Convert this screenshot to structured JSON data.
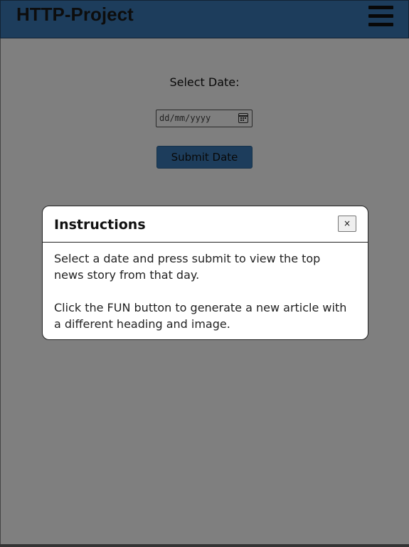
{
  "navbar": {
    "brand": "HTTP-Project",
    "menu_icon": "hamburger-menu-icon"
  },
  "form": {
    "date_label": "Select Date:",
    "date_placeholder": "dd/mm/yyyy",
    "calendar_icon": "calendar-icon",
    "submit_label": "Submit Date"
  },
  "modal": {
    "title": "Instructions",
    "close_label": "×",
    "paragraph_1": "Select a date and press submit to view the top news story from that day.",
    "paragraph_2": "Click the FUN button to generate a new article with a different heading and image."
  },
  "colors": {
    "navbar_bg": "#3a7ab8",
    "overlay": "rgba(0,0,0,0.5)"
  }
}
